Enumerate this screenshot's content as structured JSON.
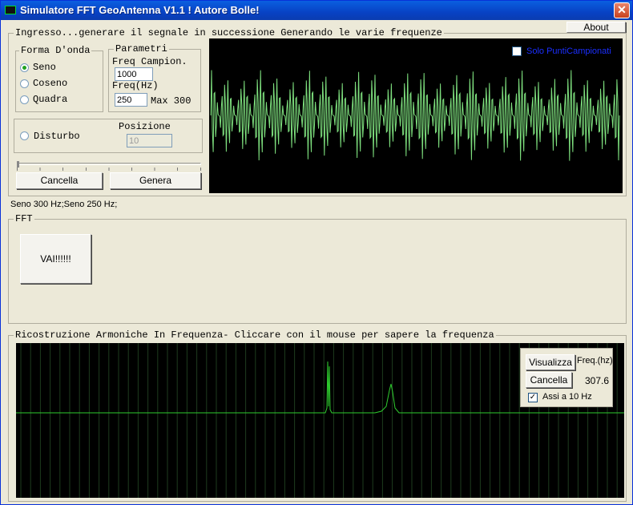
{
  "window": {
    "title": "Simulatore FFT GeoAntenna V1.1 ! Autore Bolle!",
    "close_symbol": "✕"
  },
  "about_label": "About",
  "input_section": {
    "title": "Ingresso...generare il segnale in successione Generando le varie frequenze",
    "waveform": {
      "title": "Forma D'onda",
      "options": [
        "Seno",
        "Coseno",
        "Quadra"
      ],
      "selected": "Seno"
    },
    "params": {
      "title": "Parametri",
      "sample_freq_label": "Freq Campion.",
      "sample_freq_value": "1000",
      "freq_label": "Freq(Hz)",
      "freq_value": "250",
      "max_label": "Max 300"
    },
    "noise": {
      "label": "Disturbo",
      "position_label": "Posizione",
      "position_value": "10"
    },
    "cancel_label": "Cancella",
    "generate_label": "Genera",
    "only_samples_label": "Solo PuntiCampionati"
  },
  "signal_status": "Seno 300 Hz;Seno 250 Hz;",
  "fft_section": {
    "title": "FFT",
    "run_label": "VAI!!!!!!"
  },
  "harmonics_section": {
    "title": "Ricostruzione Armoniche In Frequenza- Cliccare con il mouse per sapere la frequenza",
    "show_label": "Visualizza",
    "cancel_label": "Cancella",
    "freq_header": "Freq.(hz)",
    "freq_value": "307.6",
    "axes_label": "Assi a 10 Hz",
    "axes_checked": true
  },
  "colors": {
    "plot_bg": "#000000",
    "trace": "#7ee07e",
    "spectrum": "#2ecc2e",
    "grid": "#1e3b1e"
  }
}
